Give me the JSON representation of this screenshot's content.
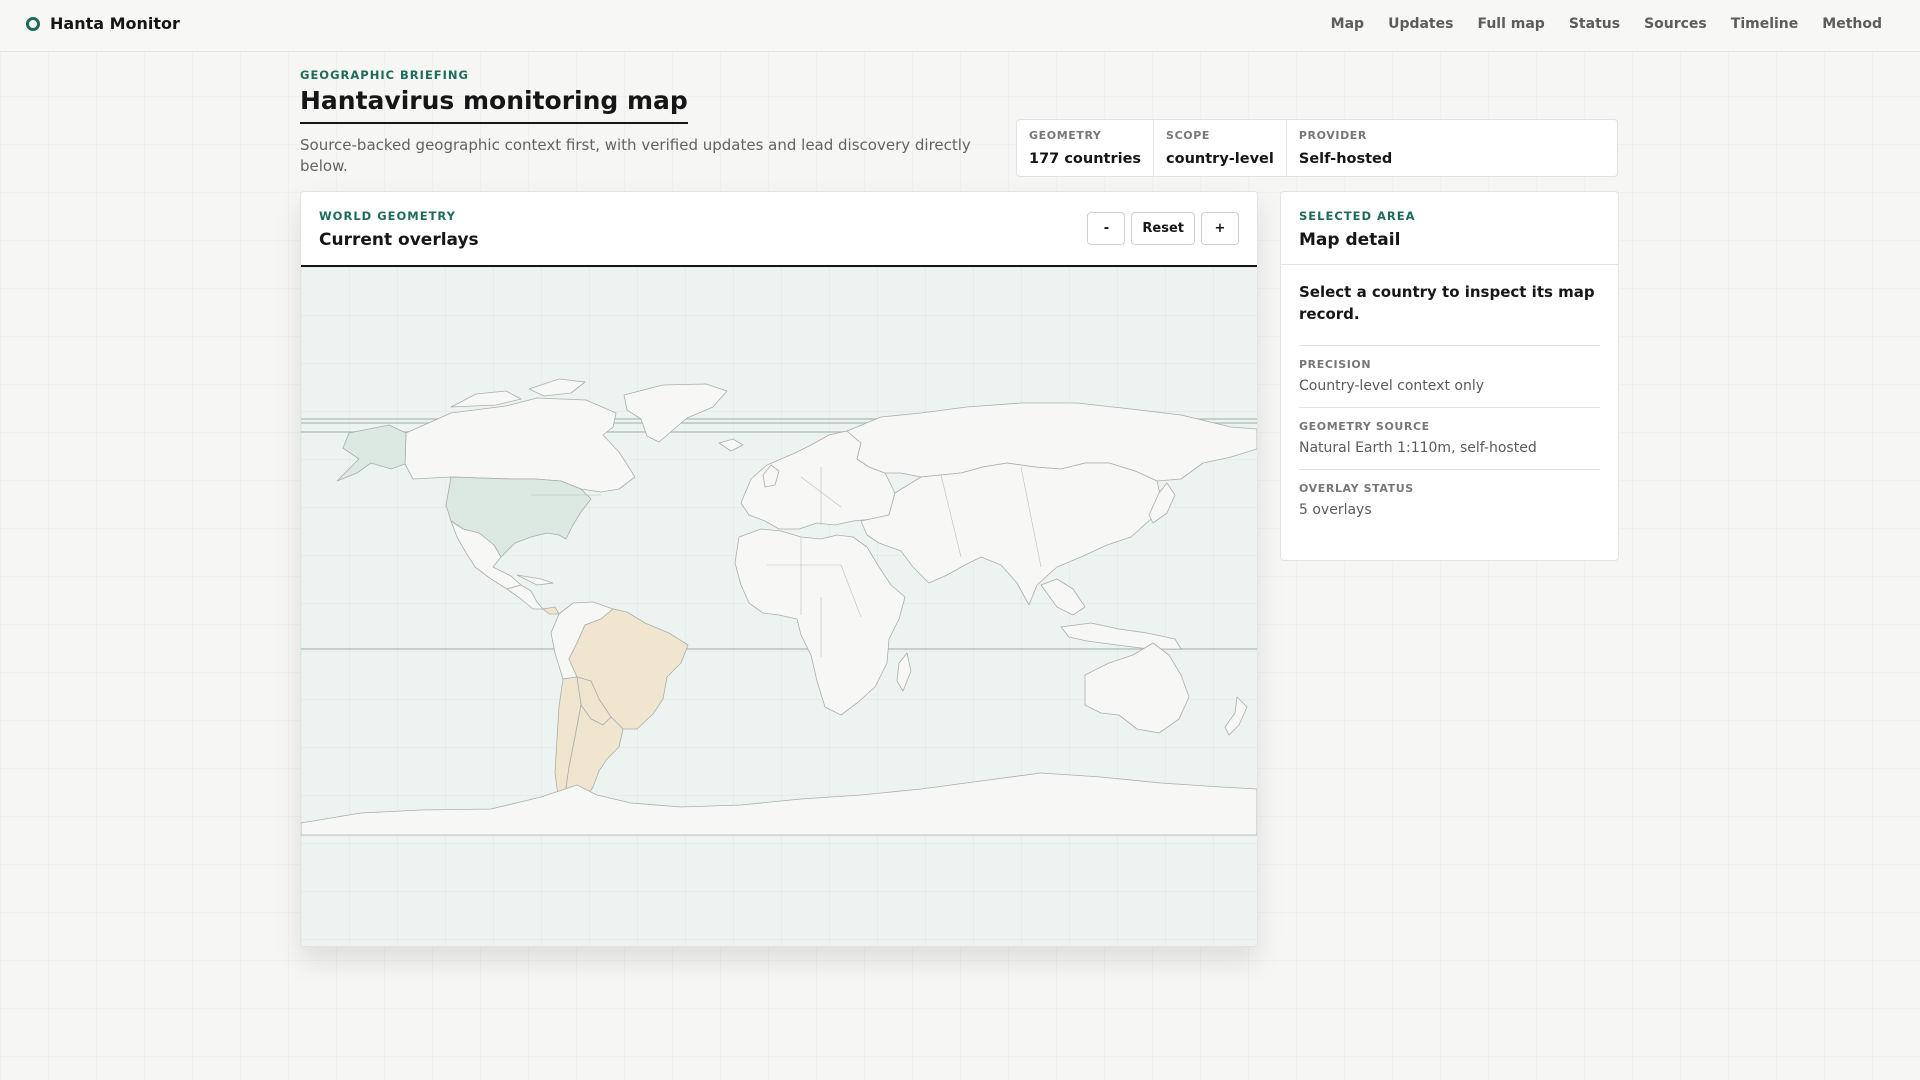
{
  "brand": {
    "name": "Hanta Monitor"
  },
  "nav": [
    {
      "label": "Map"
    },
    {
      "label": "Updates"
    },
    {
      "label": "Full map"
    },
    {
      "label": "Status"
    },
    {
      "label": "Sources"
    },
    {
      "label": "Timeline"
    },
    {
      "label": "Method"
    }
  ],
  "hero": {
    "eyebrow": "GEOGRAPHIC BRIEFING",
    "title": "Hantavirus monitoring map",
    "description": "Source-backed geographic context first, with verified updates and lead discovery directly below."
  },
  "stats": [
    {
      "label": "GEOMETRY",
      "value": "177 countries"
    },
    {
      "label": "SCOPE",
      "value": "country-level"
    },
    {
      "label": "PROVIDER",
      "value": "Self-hosted"
    }
  ],
  "map": {
    "eyebrow": "WORLD GEOMETRY",
    "title": "Current overlays",
    "controls": {
      "zoom_out": "-",
      "reset": "Reset",
      "zoom_in": "+"
    },
    "colors": {
      "land": "#f7f8f6",
      "border": "#a9aeab",
      "ocean": "#ecf3f0",
      "overlay_north_america": "#dce9e2",
      "overlay_south_america": "#f0e6d0"
    },
    "highlighted_regions": [
      "United States",
      "Brazil",
      "Argentina",
      "Chile",
      "Bolivia",
      "Paraguay",
      "Uruguay",
      "Panama"
    ]
  },
  "detail": {
    "eyebrow": "SELECTED AREA",
    "title": "Map detail",
    "prompt": "Select a country to inspect its map record.",
    "rows": [
      {
        "label": "PRECISION",
        "value": "Country-level context only"
      },
      {
        "label": "GEOMETRY SOURCE",
        "value": "Natural Earth 1:110m, self-hosted"
      },
      {
        "label": "OVERLAY STATUS",
        "value": "5 overlays"
      }
    ]
  },
  "colors": {
    "accent": "#1f6b5b",
    "text": "#161616",
    "muted": "#626262"
  }
}
